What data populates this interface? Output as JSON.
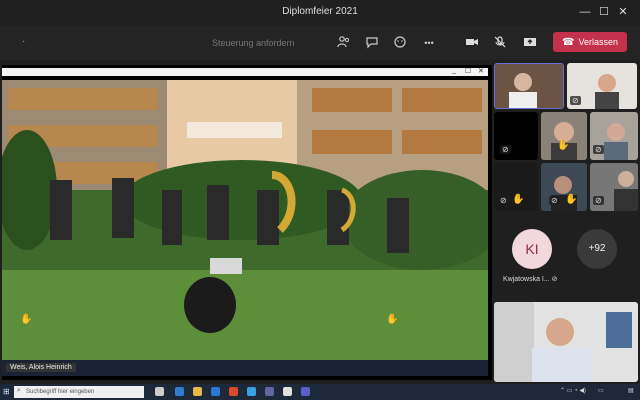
{
  "window": {
    "title": "Diplomfeier 2021",
    "minimize": "—",
    "maximize": "☐",
    "close": "✕"
  },
  "toolbar": {
    "more_dash": "·",
    "control_request": "Steuerung anfordern",
    "more_label": "•••",
    "leave_label": "Verlassen",
    "icons": [
      "people-icon",
      "chat-icon",
      "reactions-icon",
      "more-icon",
      "camera-icon",
      "mic-off-icon",
      "share-icon",
      "phone-icon"
    ]
  },
  "stage": {
    "presenter_name": "Weis, Alois Heinrich",
    "window_controls": [
      "_",
      "☐",
      "✕"
    ]
  },
  "participants": {
    "tile_name": "Kwjatowska I...",
    "avatar_initials": "KI",
    "overflow_count": "+92"
  },
  "taskbar": {
    "search_placeholder": "Suchbegriff hier eingeben"
  },
  "colors": {
    "leave": "#c4314b",
    "background": "#1f1f1f",
    "avatar_bg": "#f2d7dc"
  }
}
